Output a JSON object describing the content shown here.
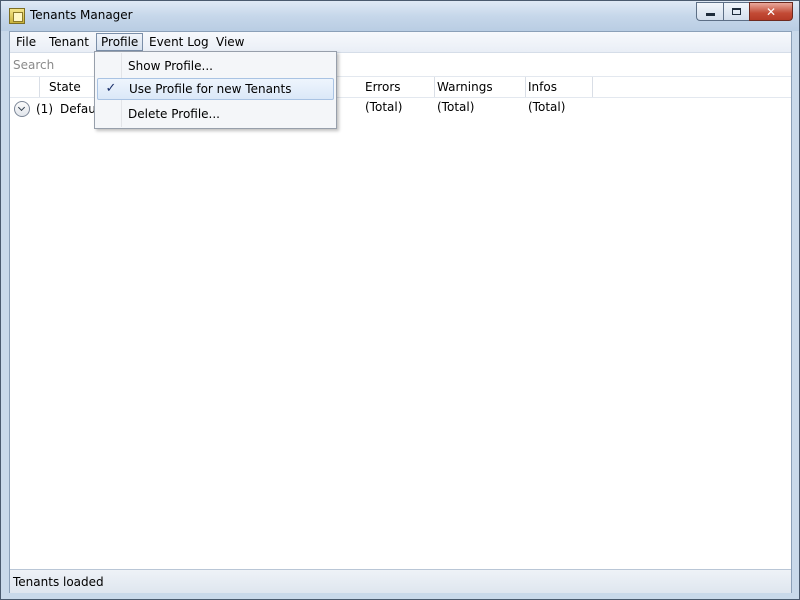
{
  "window": {
    "title": "Tenants Manager"
  },
  "menu": {
    "items": [
      {
        "label": "File"
      },
      {
        "label": "Tenant"
      },
      {
        "label": "Profile"
      },
      {
        "label": "Event Log"
      },
      {
        "label": "View"
      }
    ],
    "active": "Profile"
  },
  "search": {
    "placeholder": "Search"
  },
  "grid": {
    "columns": [
      {
        "label": "State"
      },
      {
        "label": "Errors (Total)"
      },
      {
        "label": "Warnings (Total)"
      },
      {
        "label": "Infos (Total)"
      }
    ],
    "rows": [
      {
        "count": "(1)",
        "name": "Default"
      }
    ]
  },
  "profile_menu": {
    "items": [
      {
        "label": "Show Profile...",
        "checked": false
      },
      {
        "label": "Use Profile for new Tenants",
        "checked": true
      },
      {
        "label": "Delete Profile...",
        "checked": false
      }
    ]
  },
  "status": {
    "text": "Tenants loaded"
  },
  "colors": {
    "accent": "#1a2f6a",
    "close_button": "#c24a35"
  }
}
